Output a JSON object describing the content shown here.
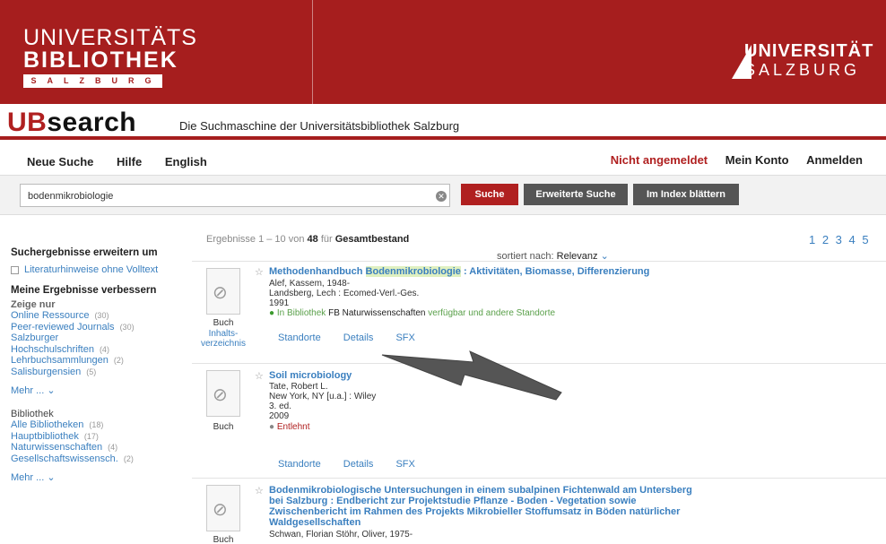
{
  "banner": {
    "ub_line1": "UNIVERSITÄTS",
    "ub_line2": "BIBLIOTHEK",
    "ub_line3": "SALZBURG",
    "uni_line1": "UNIVERSITÄT",
    "uni_line2": "SALZBURG"
  },
  "brand": {
    "ub": "UB",
    "search": "search",
    "tagline": "Die Suchmaschine der Universitätsbibliothek Salzburg"
  },
  "nav": {
    "new_search": "Neue Suche",
    "help": "Hilfe",
    "english": "English",
    "not_logged": "Nicht angemeldet",
    "account": "Mein Konto",
    "login": "Anmelden"
  },
  "search": {
    "value": "bodenmikrobiologie",
    "search_btn": "Suche",
    "advanced_btn": "Erweiterte Suche",
    "index_btn": "Im Index blättern"
  },
  "sidebar": {
    "expand_heading": "Suchergebnisse erweitern um",
    "expand_option": "Literaturhinweise ohne Volltext",
    "refine_heading": "Meine Ergebnisse verbessern",
    "show_only": "Zeige nur",
    "facets": [
      {
        "label": "Online Ressource",
        "count": "(30)"
      },
      {
        "label": "Peer-reviewed Journals",
        "count": "(30)"
      },
      {
        "label": "Salzburger Hochschulschriften",
        "count": "(4)"
      },
      {
        "label": "Lehrbuchsammlungen",
        "count": "(2)"
      },
      {
        "label": "Salisburgensien",
        "count": "(5)"
      }
    ],
    "more1": "Mehr ...",
    "library_heading": "Bibliothek",
    "libraries": [
      {
        "label": "Alle Bibliotheken",
        "count": "(18)"
      },
      {
        "label": "Hauptbibliothek",
        "count": "(17)"
      },
      {
        "label": "Naturwissenschaften",
        "count": "(4)"
      },
      {
        "label": "Gesellschaftswissensch.",
        "count": "(2)"
      }
    ],
    "more2": "Mehr ..."
  },
  "results": {
    "info_prefix": "Ergebnisse 1 – 10 von",
    "total": "48",
    "info_for": "für",
    "scope": "Gesamtbestand",
    "sorted_label": "sortiert nach:",
    "sorted_value": "Relevanz",
    "pages": "1 2 3 4 5",
    "records": [
      {
        "title_pre": "Methodenhandbuch ",
        "title_hl": "Bodenmikrobiologie",
        "title_post": " : Aktivitäten, Biomasse, Differenzierung",
        "author": "Alef, Kassem, 1948-",
        "publisher": "Landsberg, Lech : Ecomed-Verl.-Ges.",
        "year": "1991",
        "avail_status": "In Bibliothek",
        "avail_location": "FB Naturwissenschaften",
        "avail_extra": "verfügbar und andere Standorte",
        "type": "Buch",
        "toc": "Inhalts-verzeichnis",
        "actions": [
          "Standorte",
          "Details",
          "SFX"
        ]
      },
      {
        "title": "Soil microbiology",
        "author": "Tate, Robert L.",
        "publisher": "New York, NY [u.a.] : Wiley",
        "edition": "3. ed.",
        "year": "2009",
        "avail_status": "Entlehnt",
        "type": "Buch",
        "actions": [
          "Standorte",
          "Details",
          "SFX"
        ]
      },
      {
        "title_line1": "Bodenmikrobiologische Untersuchungen in einem subalpinen Fichtenwald am Untersberg",
        "title_line2": "bei Salzburg : Endbericht zur Projektstudie Pflanze - Boden - Vegetation sowie",
        "title_line3": "Zwischenbericht im Rahmen des Projekts Mikrobieller Stoffumsatz in Böden natürlicher",
        "title_line4": "Waldgesellschaften",
        "author": "Schwan, Florian Stöhr, Oliver, 1975-",
        "type": "Buch"
      }
    ]
  },
  "colors": {
    "brand_red": "#a61e1e",
    "link_blue": "#3a7fbf",
    "button_gray": "#555555"
  }
}
